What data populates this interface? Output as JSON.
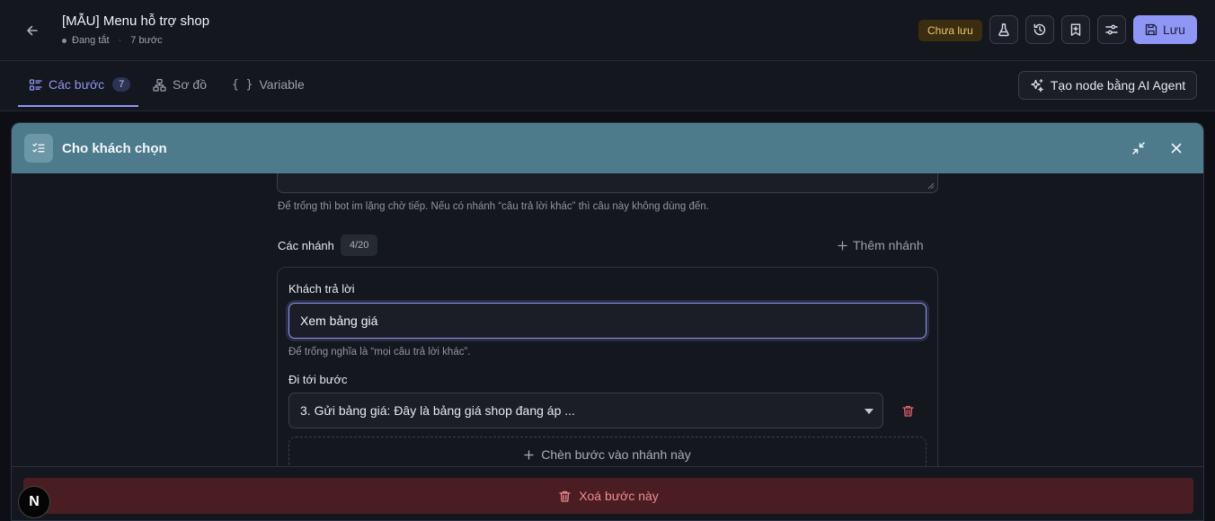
{
  "header": {
    "title": "[MẪU] Menu hỗ trợ shop",
    "status": "Đang tắt",
    "step_count": "7 bước",
    "unsaved_badge": "Chưa lưu",
    "save_label": "Lưu"
  },
  "tabs": [
    {
      "label": "Các bước",
      "count": "7"
    },
    {
      "label": "Sơ đồ"
    },
    {
      "label": "Variable"
    }
  ],
  "ai_button_label": "Tạo node bằng AI Agent",
  "panel": {
    "title": "Cho khách chọn",
    "reply_hint": "Để trống thì bot im lặng chờ tiếp. Nếu có nhánh “câu trả lời khác” thì câu này không dùng đến.",
    "branches_label": "Các nhánh",
    "branches_count": "4/20",
    "add_branch_label": "Thêm nhánh",
    "branch": {
      "answer_label": "Khách trả lời",
      "answer_value": "Xem bảng giá",
      "answer_hint": "Để trống nghĩa là “mọi câu trả lời khác”.",
      "goto_label": "Đi tới bước",
      "goto_value": "3. Gửi bảng giá: Đây là bảng giá shop đang áp ...",
      "insert_step_label": "Chèn bước vào nhánh này"
    },
    "delete_step_label": "Xoá bước này"
  },
  "badge_letter": "N",
  "colors": {
    "accent": "#8e97f5",
    "panel_header": "#4d7b8c",
    "danger": "#f08a92",
    "warning": "#f0c56a"
  }
}
